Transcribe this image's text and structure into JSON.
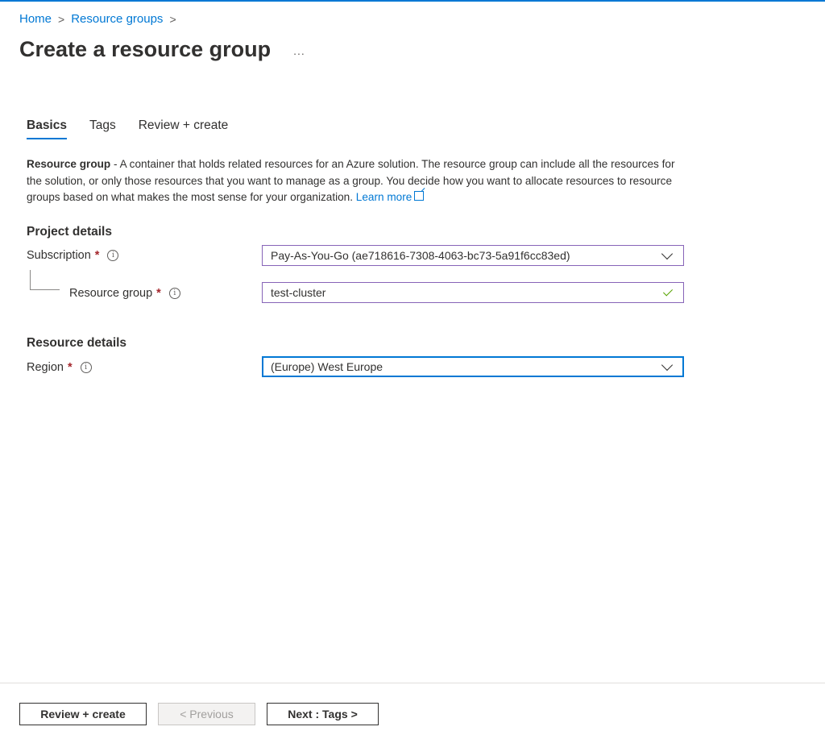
{
  "breadcrumb": {
    "items": [
      "Home",
      "Resource groups"
    ],
    "separator": ">"
  },
  "header": {
    "title": "Create a resource group",
    "more_label": "..."
  },
  "tabs": [
    {
      "label": "Basics",
      "active": true
    },
    {
      "label": "Tags",
      "active": false
    },
    {
      "label": "Review + create",
      "active": false
    }
  ],
  "description": {
    "bold": "Resource group",
    "text": " - A container that holds related resources for an Azure solution. The resource group can include all the resources for the solution, or only those resources that you want to manage as a group. You decide how you want to allocate resources to resource groups based on what makes the most sense for your organization. ",
    "link": "Learn more"
  },
  "project_details": {
    "heading": "Project details",
    "subscription": {
      "label": "Subscription",
      "required": "*",
      "value": "Pay-As-You-Go (ae718616-7308-4063-bc73-5a91f6cc83ed)"
    },
    "resource_group": {
      "label": "Resource group",
      "required": "*",
      "value": "test-cluster"
    }
  },
  "resource_details": {
    "heading": "Resource details",
    "region": {
      "label": "Region",
      "required": "*",
      "value": "(Europe) West Europe"
    }
  },
  "footer": {
    "review_create_label": "Review + create",
    "previous_label": "< Previous",
    "next_label": "Next : Tags >"
  },
  "colors": {
    "accent": "#0078d4",
    "input_border": "#8764b8",
    "required": "#a4262c",
    "valid_check": "#57a300"
  }
}
